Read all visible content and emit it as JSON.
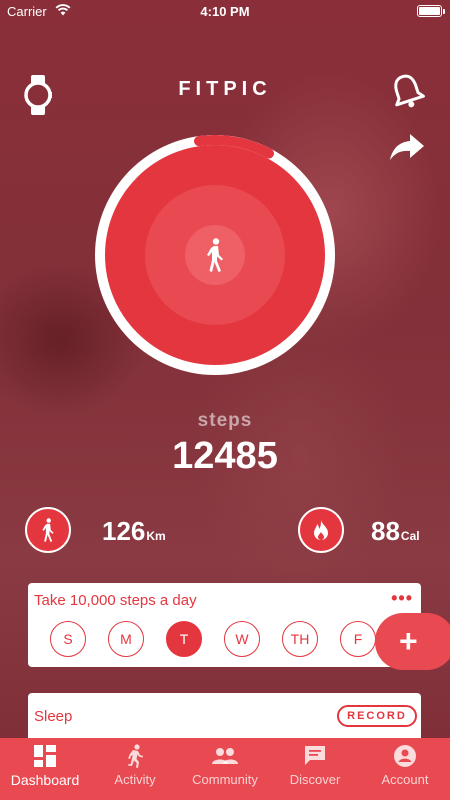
{
  "status_bar": {
    "carrier": "Carrier",
    "time": "4:10 PM"
  },
  "header": {
    "title": "FITPIC"
  },
  "activity": {
    "steps_label": "steps",
    "steps_value": "12485",
    "ring_progress": 0.1
  },
  "stats": {
    "distance": {
      "value": "126",
      "unit": "Km"
    },
    "calories": {
      "value": "88",
      "unit": "Cal"
    }
  },
  "goal_card": {
    "title": "Take 10,000 steps a day",
    "menu_label": "•••",
    "days": [
      "S",
      "M",
      "T",
      "W",
      "TH",
      "F"
    ],
    "active_day": "T"
  },
  "fab": {
    "label": "+"
  },
  "sleep_card": {
    "title": "Sleep",
    "record_label": "RECORD"
  },
  "tabbar": {
    "items": [
      {
        "label": "Dashboard",
        "icon": "dashboard-icon",
        "active": true
      },
      {
        "label": "Activity",
        "icon": "running-icon",
        "active": false
      },
      {
        "label": "Community",
        "icon": "group-icon",
        "active": false
      },
      {
        "label": "Discover",
        "icon": "chat-icon",
        "active": false
      },
      {
        "label": "Account",
        "icon": "account-icon",
        "active": false
      }
    ]
  },
  "colors": {
    "accent": "#e4363f",
    "background": "#7d2c36",
    "tabbar": "#e94a52"
  }
}
